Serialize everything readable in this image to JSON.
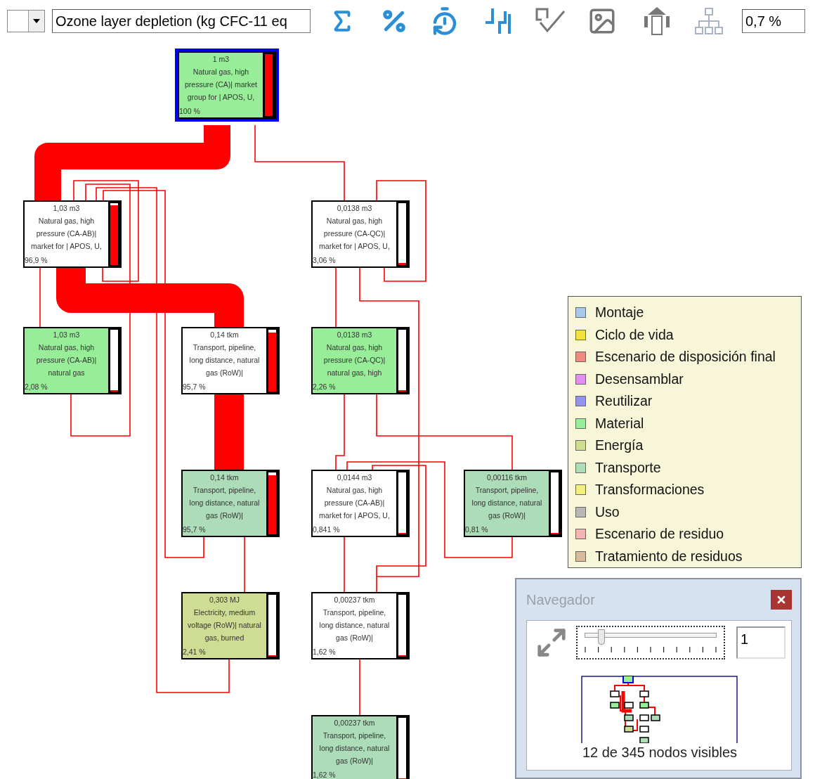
{
  "toolbar": {
    "indicator_field": {
      "value": "Ozone layer depletion (kg CFC-11 eq"
    },
    "cutoff_field": {
      "value": "0,7 %"
    }
  },
  "nodes": [
    {
      "amount": "1 m3",
      "name": "Natural gas, high pressure (CA)| market group for | APOS, U,",
      "share": "100 %",
      "color": "#98ee98",
      "selected": true,
      "level": 1
    },
    {
      "amount": "1,03 m3",
      "name": "Natural gas, high pressure (CA-AB)| market for | APOS, U,",
      "share": "96,9 %",
      "color": "#ffffff",
      "selected": false,
      "level": 0.97
    },
    {
      "amount": "0,0138 m3",
      "name": "Natural gas, high pressure (CA-QC)| market for | APOS, U,",
      "share": "3,06 %",
      "color": "#ffffff",
      "selected": false,
      "level": 0.03
    },
    {
      "amount": "1,03 m3",
      "name": "Natural gas, high pressure (CA-AB)| natural gas",
      "share": "2,08 %",
      "color": "#98ee98",
      "selected": false,
      "level": 0.02
    },
    {
      "amount": "0,14 tkm",
      "name": "Transport, pipeline, long distance, natural gas (RoW)|",
      "share": "95,7 %",
      "color": "#ffffff",
      "selected": false,
      "level": 0.96
    },
    {
      "amount": "0,0138 m3",
      "name": "Natural gas, high pressure (CA-QC)| natural gas, high",
      "share": "2,26 %",
      "color": "#98ee98",
      "selected": false,
      "level": 0.02
    },
    {
      "amount": "0,14 tkm",
      "name": "Transport, pipeline, long distance, natural gas (RoW)|",
      "share": "95,7 %",
      "color": "#acdcb8",
      "selected": false,
      "level": 0.96
    },
    {
      "amount": "0,0144 m3",
      "name": "Natural gas, high pressure (CA-AB)| market for | APOS, U,",
      "share": "0,841 %",
      "color": "#ffffff",
      "selected": false,
      "level": 0.01
    },
    {
      "amount": "0,00116 tkm",
      "name": "Transport, pipeline, long distance, natural gas (RoW)|",
      "share": "0,81 %",
      "color": "#acdcb8",
      "selected": false,
      "level": 0.01
    },
    {
      "amount": "0,303 MJ",
      "name": "Electricity, medium voltage (RoW)| natural gas, burned",
      "share": "2,41 %",
      "color": "#cfdd94",
      "selected": false,
      "level": 0.02
    },
    {
      "amount": "0,00237 tkm",
      "name": "Transport, pipeline, long distance, natural gas (RoW)|",
      "share": "1,62 %",
      "color": "#ffffff",
      "selected": false,
      "level": 0.02
    },
    {
      "amount": "0,00237 tkm",
      "name": "Transport, pipeline, long distance, natural gas (RoW)|",
      "share": "1,62 %",
      "color": "#acdcb8",
      "selected": false,
      "level": 0.02
    }
  ],
  "legend": [
    {
      "label": "Montaje",
      "color": "#a8c8f0"
    },
    {
      "label": "Ciclo de vida",
      "color": "#f4e23c"
    },
    {
      "label": "Escenario de disposición final",
      "color": "#f08a80"
    },
    {
      "label": "Desensamblar",
      "color": "#e08ef0"
    },
    {
      "label": "Reutilizar",
      "color": "#9494f0"
    },
    {
      "label": "Material",
      "color": "#98ee98"
    },
    {
      "label": "Energía",
      "color": "#cfdd94"
    },
    {
      "label": "Transporte",
      "color": "#acdcb8"
    },
    {
      "label": "Transformaciones",
      "color": "#f2f07c"
    },
    {
      "label": "Uso",
      "color": "#b8b8b8"
    },
    {
      "label": "Escenario de residuo",
      "color": "#f4b4b4"
    },
    {
      "label": "Tratamiento de residuos",
      "color": "#d8ba9c"
    }
  ],
  "navigator": {
    "title": "Navegador",
    "zoom_slider": {
      "level": 0.12
    },
    "zoom_field": {
      "value": "1"
    },
    "status": "12 de 345 nodos visibles"
  }
}
